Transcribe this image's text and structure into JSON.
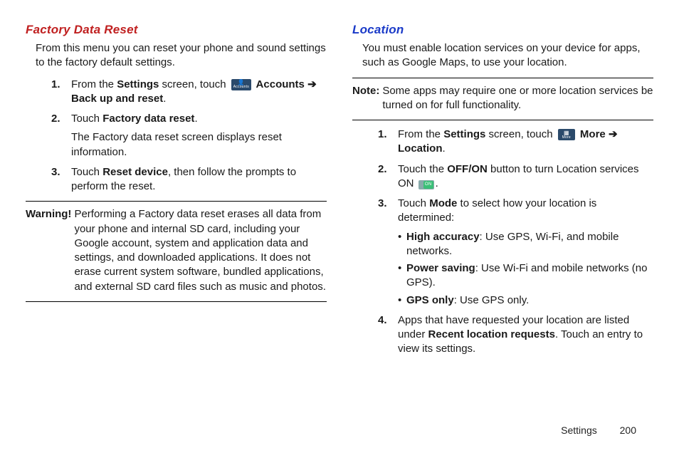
{
  "left": {
    "heading": "Factory Data Reset",
    "intro": "From this menu you can reset your phone and sound settings to the factory default settings.",
    "step1_a": "From the ",
    "step1_b": "Settings",
    "step1_c": " screen, touch ",
    "step1_icon_label": "Accounts",
    "step1_d": " Accounts ",
    "step1_arrow": "➔",
    "step1_e": "Back up and reset",
    "step2_a": "Touch ",
    "step2_b": "Factory data reset",
    "step2_sub": "The Factory data reset screen displays reset information.",
    "step3_a": "Touch ",
    "step3_b": "Reset device",
    "step3_c": ", then follow the prompts to perform the reset.",
    "warn_label": "Warning!",
    "warn_body": "Performing a Factory data reset erases all data from your phone and internal SD card, including your Google account, system and application data and settings, and downloaded applications. It does not erase current system software, bundled applications, and external SD card files such as music and photos."
  },
  "right": {
    "heading": "Location",
    "intro": "You must enable location services on your device for apps, such as Google Maps, to use your location.",
    "note_label": "Note:",
    "note_body": "Some apps may require one or more location services be turned on for full functionality.",
    "step1_a": "From the ",
    "step1_b": "Settings",
    "step1_c": " screen, touch ",
    "step1_icon_label": "More",
    "step1_d": " More ",
    "step1_arrow": "➔",
    "step1_e": "Location",
    "step2_a": "Touch the ",
    "step2_b": "OFF/ON",
    "step2_c": " button to turn Location services ON ",
    "step2_toggle": "ON",
    "step3_a": "Touch ",
    "step3_b": "Mode",
    "step3_c": " to select how your location is determined:",
    "b1_a": "High accuracy",
    "b1_b": ": Use GPS, Wi-Fi, and mobile networks.",
    "b2_a": "Power saving",
    "b2_b": ": Use Wi-Fi and mobile networks (no GPS).",
    "b3_a": "GPS only",
    "b3_b": ": Use GPS only.",
    "step4_a": "Apps that have requested your location are listed under ",
    "step4_b": "Recent location requests",
    "step4_c": ". Touch an entry to view its settings."
  },
  "footer": {
    "section": "Settings",
    "page": "200"
  }
}
